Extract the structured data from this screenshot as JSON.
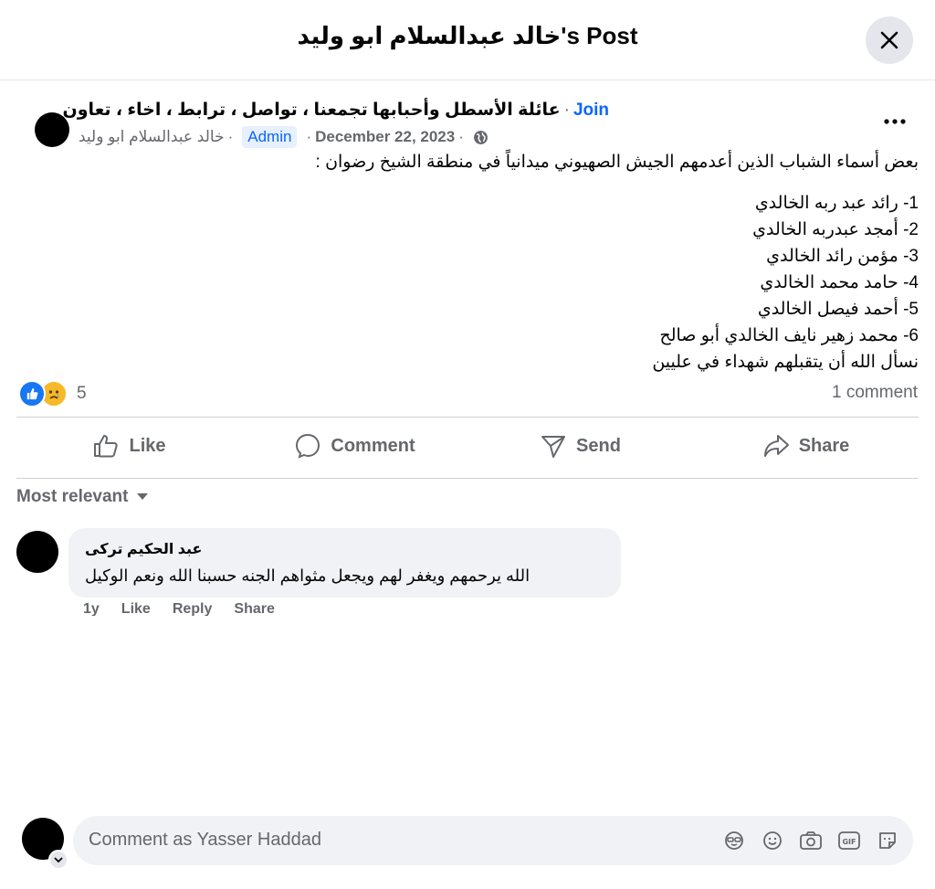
{
  "header": {
    "title": "خالد عبدالسلام ابو وليد's Post",
    "close_icon": "close-icon"
  },
  "post": {
    "group_name": "عائلة الأسطل وأحبابها تجمعنا ، تواصل ، ترابط ، اخاء ، تعاون",
    "join_label": "Join",
    "author": "خالد عبدالسلام ابو وليد",
    "author_badge": "Admin",
    "date": "December 22, 2023",
    "privacy_icon": "globe-icon",
    "intro": "بعض أسماء الشباب الذين أعدمهم الجيش الصهيوني ميدانياً في منطقة الشيخ رضوان :",
    "names": [
      "1- رائد عبد ربه الخالدي",
      "2- أمجد عبدربه الخالدي",
      "3- مؤمن رائد الخالدي",
      "4- حامد محمد الخالدي",
      "5- أحمد فيصل الخالدي",
      "6- محمد زهير نايف الخالدي أبو صالح"
    ],
    "closing": "نسأل الله أن يتقبلهم شهداء في عليين",
    "reaction_count": "5",
    "comment_count": "1 comment"
  },
  "actions": {
    "like": "Like",
    "comment": "Comment",
    "send": "Send",
    "share": "Share"
  },
  "comments_sort": "Most relevant",
  "comment": {
    "author": "عبد الحكيم تركى",
    "text": "الله يرحمهم ويغفر لهم ويجعل مثواهم الجنه حسبنا الله ونعم الوكيل",
    "time": "1y",
    "like": "Like",
    "reply": "Reply",
    "share": "Share"
  },
  "composer": {
    "placeholder": "Comment as Yasser Haddad",
    "icons": [
      "avatar-sticker-icon",
      "emoji-icon",
      "camera-icon",
      "gif-icon",
      "sticker-icon"
    ]
  },
  "colors": {
    "accent": "#0866ff",
    "secondary_text": "#65676b",
    "bubble": "#f0f2f5"
  }
}
